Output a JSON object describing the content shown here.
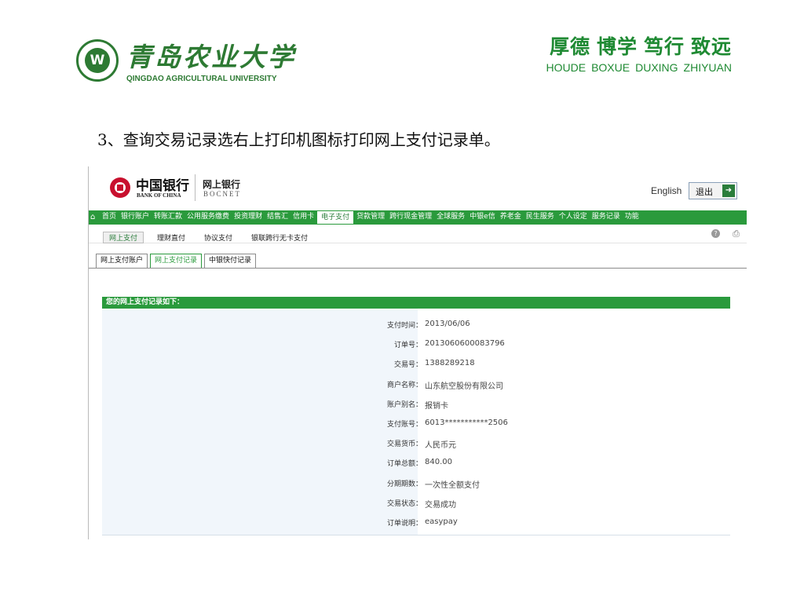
{
  "slide": {
    "university": {
      "name_cn": "青岛农业大学",
      "name_en": "QINGDAO AGRICULTURAL UNIVERSITY",
      "seal_letter": "W"
    },
    "motto": {
      "cn": [
        "厚德",
        "博学",
        "笃行",
        "致远"
      ],
      "en": [
        "HOUDE",
        "BOXUE",
        "DUXING",
        "ZHIYUAN"
      ],
      "color": "#1f8a33"
    },
    "instruction": "3、查询交易记录选右上打印机图标打印网上支付记录单。"
  },
  "bank": {
    "logo_cn": "中国银行",
    "logo_en": "BANK OF CHINA",
    "product_cn": "网上银行",
    "product_en": "BOCNET",
    "language_link": "English",
    "logout_label": "退出",
    "brand_color": "#2a9a3c",
    "main_nav": [
      "首页",
      "银行账户",
      "转账汇款",
      "公用服务缴费",
      "投资理财",
      "结售汇",
      "信用卡",
      "电子支付",
      "贷款管理",
      "跨行现金管理",
      "全球服务",
      "中银e信",
      "养老金",
      "民生服务",
      "个人设定",
      "服务记录",
      "功能"
    ],
    "main_nav_active": 7,
    "sub_nav": [
      "网上支付",
      "理财直付",
      "协议支付",
      "银联跨行无卡支付"
    ],
    "sub_nav_active": 0,
    "tabs": [
      "网上支付账户",
      "网上支付记录",
      "中银快付记录"
    ],
    "tab_active": 1,
    "record_title": "您的网上支付记录如下：",
    "records": [
      {
        "label": "支付时间：",
        "value": "2013/06/06"
      },
      {
        "label": "订单号：",
        "value": "2013060600083796"
      },
      {
        "label": "交易号：",
        "value": "1388289218"
      },
      {
        "label": "商户名称：",
        "value": "山东航空股份有限公司"
      },
      {
        "label": "账户别名：",
        "value": "报销卡"
      },
      {
        "label": "支付账号：",
        "value": "6013***********2506"
      },
      {
        "label": "交易货币：",
        "value": "人民币元"
      },
      {
        "label": "订单总额：",
        "value": "840.00"
      },
      {
        "label": "分期期数：",
        "value": "一次性全额支付"
      },
      {
        "label": "交易状态：",
        "value": "交易成功"
      },
      {
        "label": "订单说明：",
        "value": "easypay"
      }
    ]
  }
}
